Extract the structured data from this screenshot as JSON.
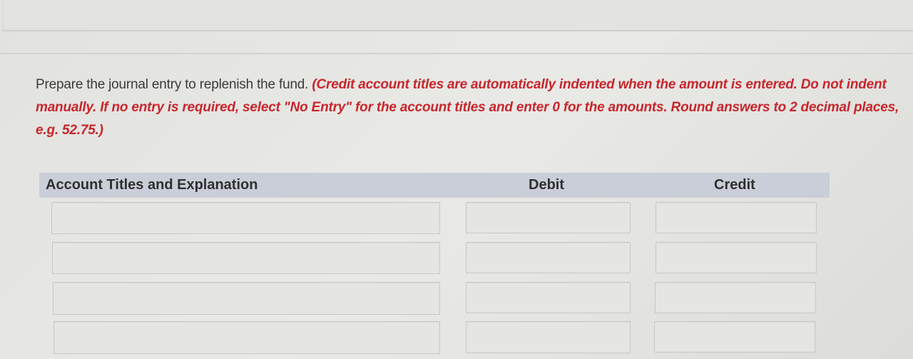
{
  "question": {
    "prompt": "Prepare the journal entry to replenish the fund.",
    "instructions": "(Credit account titles are automatically indented when the amount is entered. Do not indent manually. If no entry is required, select \"No Entry\" for the account titles and enter 0 for the amounts. Round answers to 2 decimal places, e.g. 52.75.)"
  },
  "table": {
    "headers": {
      "account": "Account Titles and Explanation",
      "debit": "Debit",
      "credit": "Credit"
    },
    "rows": [
      {
        "account": "",
        "debit": "",
        "credit": ""
      },
      {
        "account": "",
        "debit": "",
        "credit": ""
      },
      {
        "account": "",
        "debit": "",
        "credit": ""
      },
      {
        "account": "",
        "debit": "",
        "credit": ""
      }
    ]
  }
}
